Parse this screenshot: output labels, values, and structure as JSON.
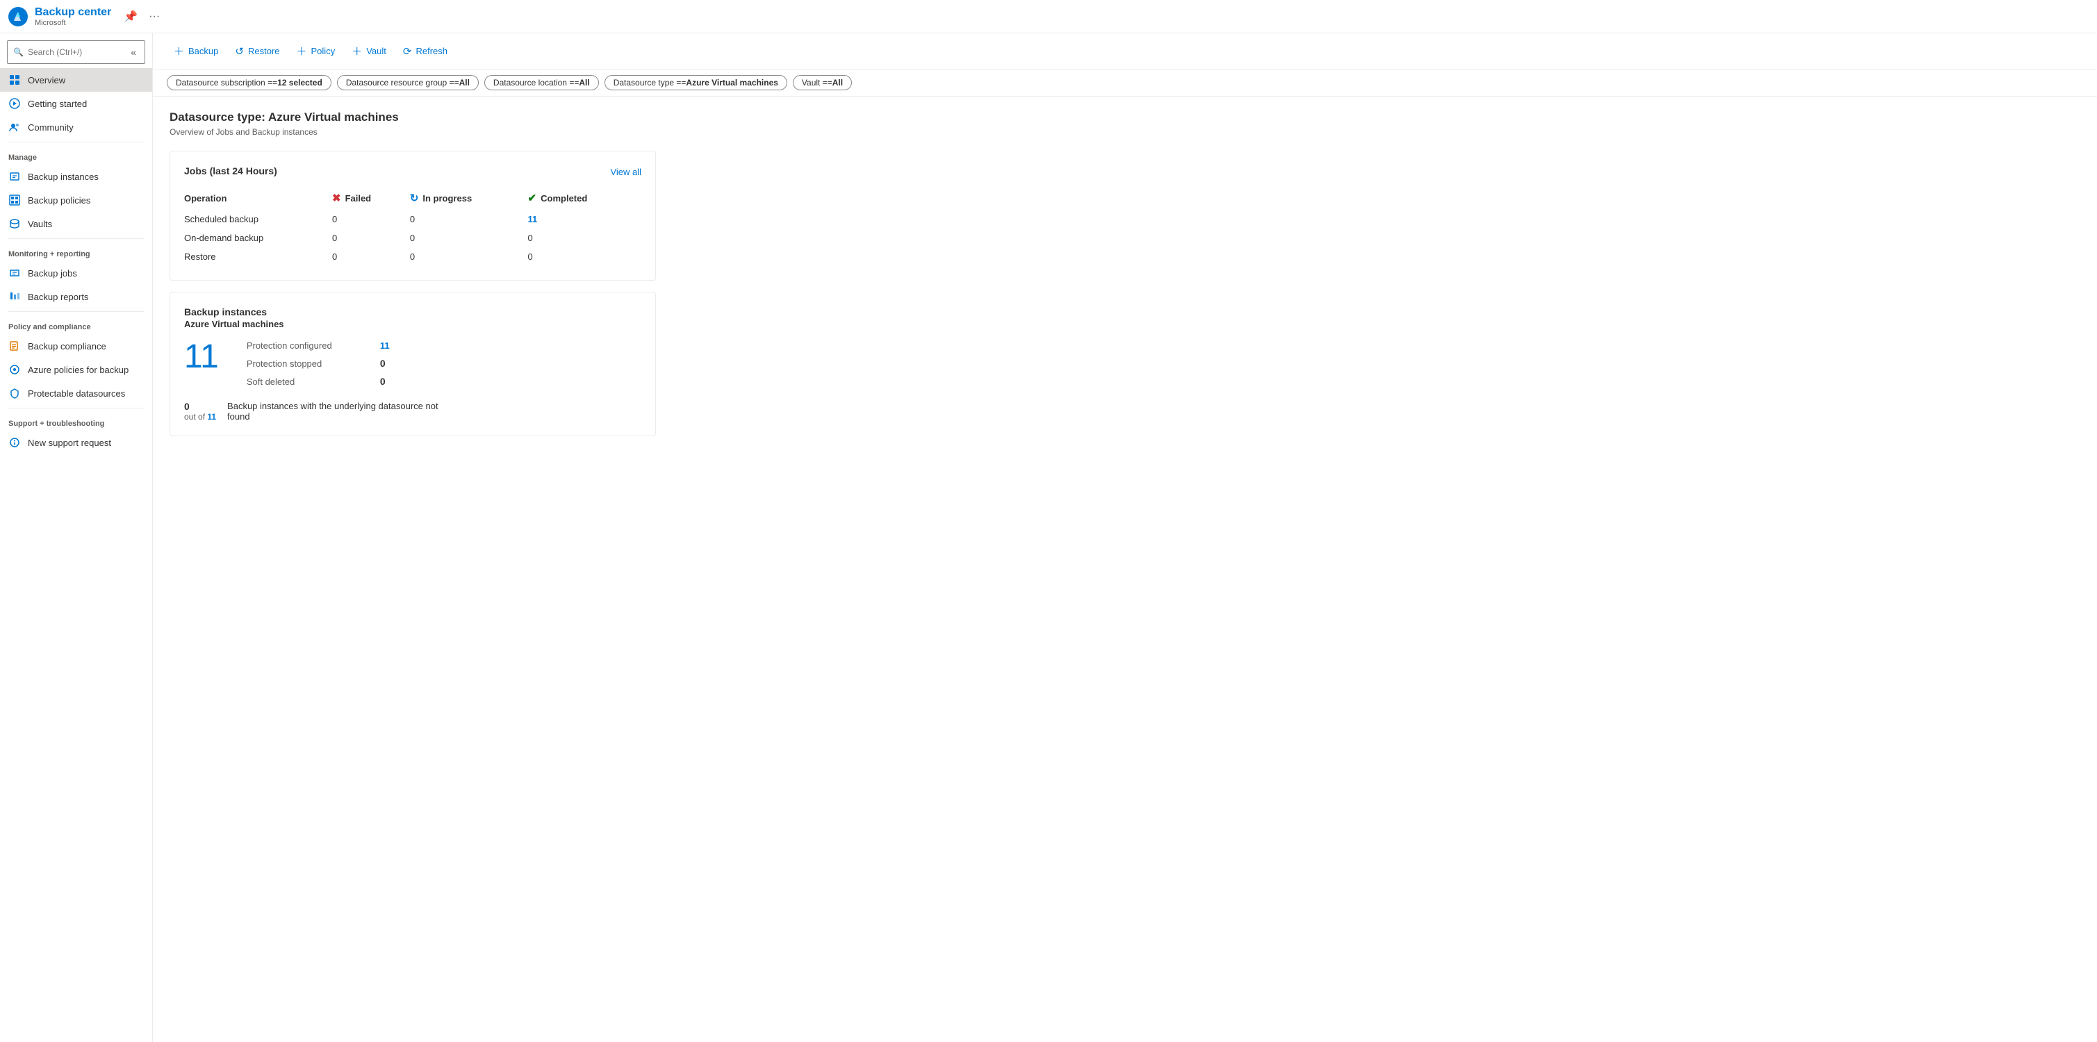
{
  "app": {
    "title": "Backup center",
    "subtitle": "Microsoft"
  },
  "search": {
    "placeholder": "Search (Ctrl+/)"
  },
  "toolbar": {
    "backup_label": "Backup",
    "restore_label": "Restore",
    "policy_label": "Policy",
    "vault_label": "Vault",
    "refresh_label": "Refresh"
  },
  "filters": [
    {
      "label": "Datasource subscription == ",
      "value": "12 selected"
    },
    {
      "label": "Datasource resource group == ",
      "value": "All"
    },
    {
      "label": "Datasource location == ",
      "value": "All"
    },
    {
      "label": "Datasource type == ",
      "value": "Azure Virtual machines"
    },
    {
      "label": "Vault == ",
      "value": "All"
    }
  ],
  "page": {
    "title": "Datasource type: Azure Virtual machines",
    "subtitle": "Overview of Jobs and Backup instances"
  },
  "sidebar": {
    "search_placeholder": "Search (Ctrl+/)",
    "items": {
      "overview": "Overview",
      "getting_started": "Getting started",
      "community": "Community",
      "manage_header": "Manage",
      "backup_instances": "Backup instances",
      "backup_policies": "Backup policies",
      "vaults": "Vaults",
      "monitoring_header": "Monitoring + reporting",
      "backup_jobs": "Backup jobs",
      "backup_reports": "Backup reports",
      "policy_header": "Policy and compliance",
      "backup_compliance": "Backup compliance",
      "azure_policies": "Azure policies for backup",
      "protectable_datasources": "Protectable datasources",
      "support_header": "Support + troubleshooting",
      "new_support": "New support request"
    }
  },
  "jobs_card": {
    "title": "Jobs (last 24 Hours)",
    "view_all": "View all",
    "headers": {
      "operation": "Operation",
      "failed": "Failed",
      "in_progress": "In progress",
      "completed": "Completed"
    },
    "rows": [
      {
        "operation": "Scheduled backup",
        "failed": "0",
        "in_progress": "0",
        "completed": "11",
        "completed_link": true
      },
      {
        "operation": "On-demand backup",
        "failed": "0",
        "in_progress": "0",
        "completed": "0",
        "completed_link": false
      },
      {
        "operation": "Restore",
        "failed": "0",
        "in_progress": "0",
        "completed": "0",
        "completed_link": false
      }
    ]
  },
  "backup_instances_card": {
    "title": "Backup instances",
    "subtitle": "Azure Virtual machines",
    "big_number": "11",
    "stats": [
      {
        "label": "Protection configured",
        "value": "11",
        "link": true
      },
      {
        "label": "Protection stopped",
        "value": "0",
        "link": false
      },
      {
        "label": "Soft deleted",
        "value": "0",
        "link": false
      }
    ],
    "bottom_number": "0",
    "bottom_out_of": "11",
    "bottom_desc": "Backup instances with the underlying datasource not found"
  }
}
